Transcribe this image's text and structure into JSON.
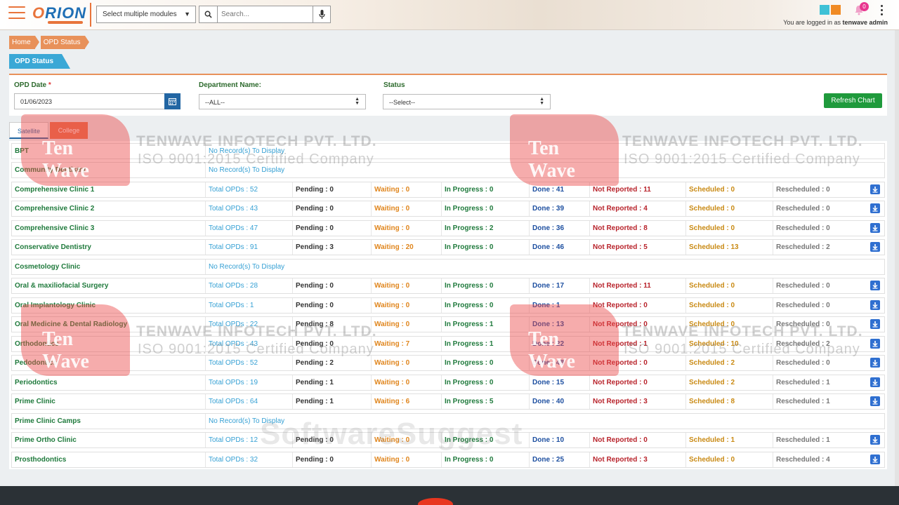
{
  "header": {
    "logo_text_o": "O",
    "logo_text_rion": "RION",
    "module_select": "Select multiple modules",
    "search_placeholder": "Search...",
    "notification_count": "0",
    "logged_prefix": "You are logged in as",
    "logged_user": "tenwave admin",
    "theme_colors": [
      "#3fc1d6",
      "#f08a24"
    ]
  },
  "breadcrumb": [
    "Home",
    "OPD Status"
  ],
  "page_tab": "OPD Status",
  "filters": {
    "date_label": "OPD Date",
    "date_required": "*",
    "date_value": "01/06/2023",
    "dept_label": "Department Name:",
    "dept_value": "--ALL--",
    "status_label": "Status",
    "status_value": "--Select--",
    "refresh_label": "Refresh Chart"
  },
  "tabs": [
    "Satellite",
    "College"
  ],
  "labels": {
    "total": "Total OPDs : ",
    "pending": "Pending : ",
    "waiting": "Waiting : ",
    "inprogress": "In Progress : ",
    "done": "Done : ",
    "notreported": "Not Reported : ",
    "scheduled": "Scheduled : ",
    "rescheduled": "Rescheduled : ",
    "no_record": "No Record(s) To Display"
  },
  "departments": [
    {
      "name": "BPT",
      "no_record": true
    },
    {
      "name": "Community Dentistry",
      "no_record": true
    },
    {
      "name": "Comprehensive Clinic 1",
      "total": 52,
      "pending": 0,
      "waiting": 0,
      "inprogress": 0,
      "done": 41,
      "notreported": 11,
      "scheduled": 0,
      "rescheduled": 0
    },
    {
      "name": "Comprehensive Clinic 2",
      "total": 43,
      "pending": 0,
      "waiting": 0,
      "inprogress": 0,
      "done": 39,
      "notreported": 4,
      "scheduled": 0,
      "rescheduled": 0
    },
    {
      "name": "Comprehensive Clinic 3",
      "total": 47,
      "pending": 0,
      "waiting": 0,
      "inprogress": 2,
      "done": 36,
      "notreported": 8,
      "scheduled": 0,
      "rescheduled": 0
    },
    {
      "name": "Conservative Dentistry",
      "total": 91,
      "pending": 3,
      "waiting": 20,
      "inprogress": 0,
      "done": 46,
      "notreported": 5,
      "scheduled": 13,
      "rescheduled": 2
    },
    {
      "name": "Cosmetology Clinic",
      "no_record": true
    },
    {
      "name": "Oral & maxiliofacial Surgery",
      "total": 28,
      "pending": 0,
      "waiting": 0,
      "inprogress": 0,
      "done": 17,
      "notreported": 11,
      "scheduled": 0,
      "rescheduled": 0
    },
    {
      "name": "Oral Implantology Clinic",
      "total": 1,
      "pending": 0,
      "waiting": 0,
      "inprogress": 0,
      "done": 1,
      "notreported": 0,
      "scheduled": 0,
      "rescheduled": 0
    },
    {
      "name": "Oral Medicine & Dental Radiology",
      "total": 22,
      "pending": 8,
      "waiting": 0,
      "inprogress": 1,
      "done": 13,
      "notreported": 0,
      "scheduled": 0,
      "rescheduled": 0
    },
    {
      "name": "Orthodontics",
      "total": 43,
      "pending": 0,
      "waiting": 7,
      "inprogress": 1,
      "done": 22,
      "notreported": 1,
      "scheduled": 10,
      "rescheduled": 2
    },
    {
      "name": "Pedodontics",
      "total": 52,
      "pending": 2,
      "waiting": 0,
      "inprogress": 0,
      "done": 48,
      "notreported": 0,
      "scheduled": 2,
      "rescheduled": 0
    },
    {
      "name": "Periodontics",
      "total": 19,
      "pending": 1,
      "waiting": 0,
      "inprogress": 0,
      "done": 15,
      "notreported": 0,
      "scheduled": 2,
      "rescheduled": 1
    },
    {
      "name": "Prime Clinic",
      "total": 64,
      "pending": 1,
      "waiting": 6,
      "inprogress": 5,
      "done": 40,
      "notreported": 3,
      "scheduled": 8,
      "rescheduled": 1
    },
    {
      "name": "Prime Clinic Camps",
      "no_record": true
    },
    {
      "name": "Prime Ortho Clinic",
      "total": 12,
      "pending": 0,
      "waiting": 0,
      "inprogress": 0,
      "done": 10,
      "notreported": 0,
      "scheduled": 1,
      "rescheduled": 1
    },
    {
      "name": "Prosthodontics",
      "total": 32,
      "pending": 0,
      "waiting": 0,
      "inprogress": 0,
      "done": 25,
      "notreported": 3,
      "scheduled": 0,
      "rescheduled": 4
    }
  ],
  "watermark": {
    "company": "TENWAVE INFOTECH PVT. LTD.",
    "iso": "ISO 9001:2015 Certified Company",
    "brand": "Ten Wave",
    "site": "SoftwareSuggest"
  }
}
